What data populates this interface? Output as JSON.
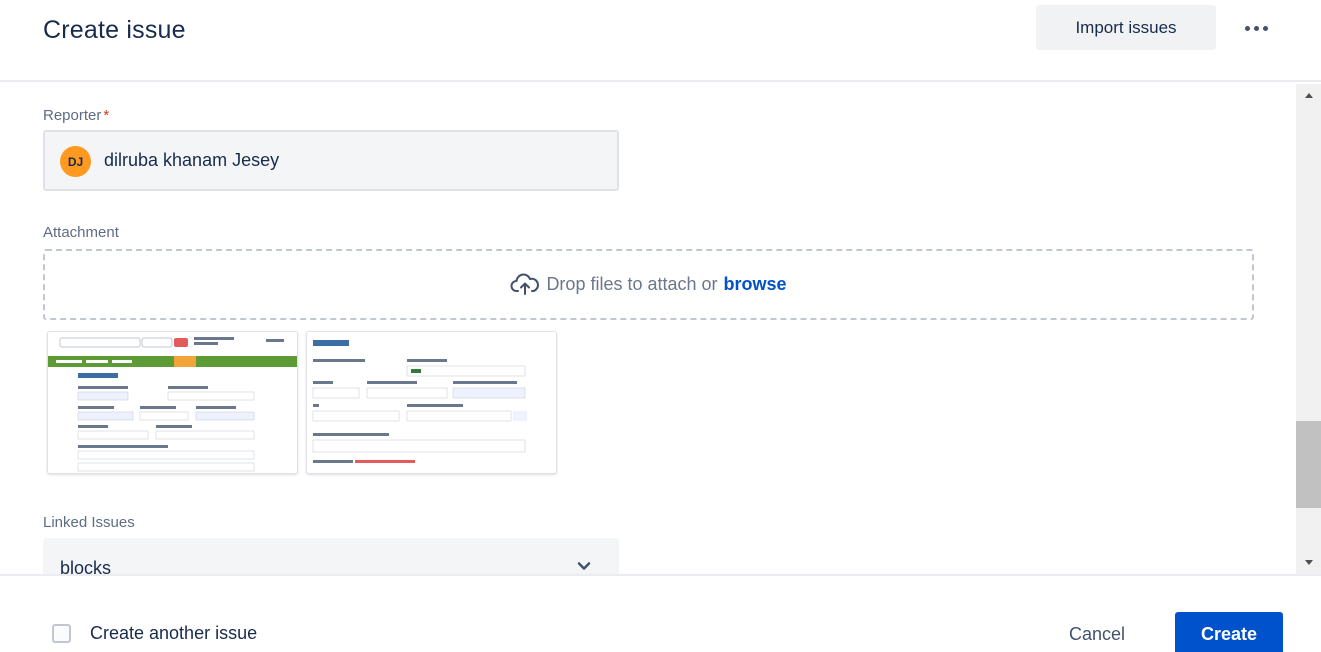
{
  "header": {
    "title": "Create issue",
    "import_label": "Import issues",
    "more_icon": "more-horizontal-icon"
  },
  "form": {
    "reporter": {
      "label": "Reporter",
      "required_marker": "*",
      "avatar_initials": "DJ",
      "value": "dilruba khanam Jesey"
    },
    "attachment": {
      "label": "Attachment",
      "drop_text": "Drop files to attach or",
      "browse_text": "browse",
      "icon": "cloud-upload-icon"
    },
    "linked_issues": {
      "label": "Linked Issues",
      "value": "blocks"
    }
  },
  "footer": {
    "create_another_label": "Create another issue",
    "create_another_checked": false,
    "cancel_label": "Cancel",
    "create_label": "Create"
  },
  "colors": {
    "primary": "#0052cc",
    "required": "#de350b",
    "avatar_bg": "#ff991f",
    "field_bg": "#f4f5f7",
    "text": "#172b4d",
    "subtle_text": "#5e6c84"
  }
}
